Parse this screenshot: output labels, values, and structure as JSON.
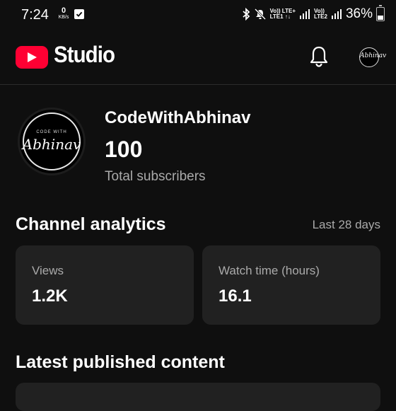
{
  "status_bar": {
    "time": "7:24",
    "data_rate": "0",
    "data_rate_unit": "KB/s",
    "sim1_top": "Vo)) LTE+",
    "sim1_bottom": "LTE1 ↑↓",
    "sim2_top": "Vo))",
    "sim2_bottom": "LTE2",
    "battery": "36%",
    "battery_level": 0.36
  },
  "header": {
    "app_name": "Studio",
    "brand_color": "#ff0033"
  },
  "channel": {
    "avatar_top_text": "CODE WITH",
    "avatar_script_text": "Abhinav",
    "name": "CodeWithAbhinav",
    "subscribers": "100",
    "subscribers_label": "Total subscribers"
  },
  "analytics": {
    "title": "Channel analytics",
    "range": "Last 28 days",
    "cards": [
      {
        "label": "Views",
        "value": "1.2K"
      },
      {
        "label": "Watch time (hours)",
        "value": "16.1"
      }
    ]
  },
  "latest": {
    "title": "Latest published content"
  }
}
